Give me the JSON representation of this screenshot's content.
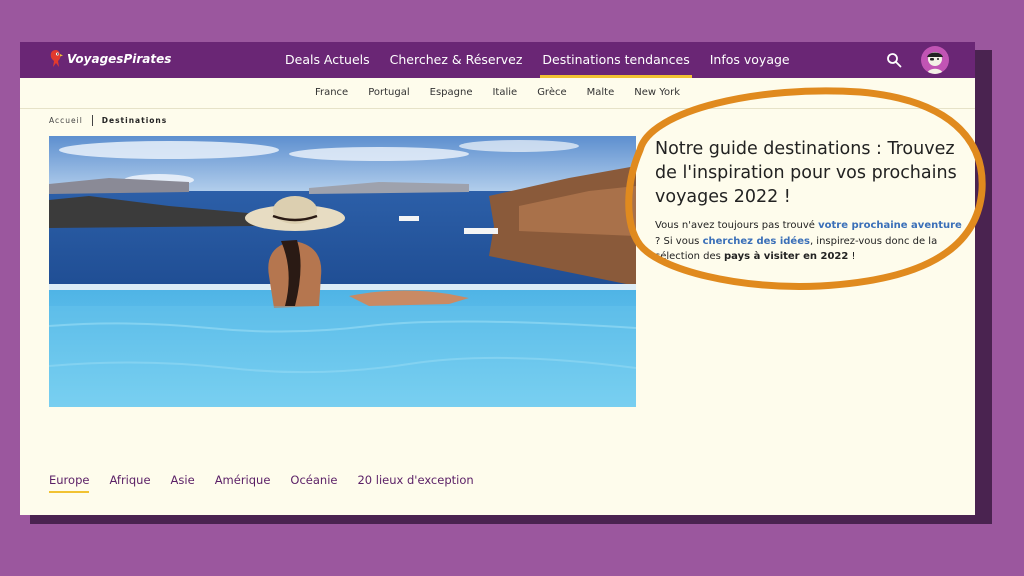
{
  "brand": {
    "name": "VoyagesPirates"
  },
  "nav": {
    "items": [
      {
        "label": "Deals Actuels",
        "active": false
      },
      {
        "label": "Cherchez & Réservez",
        "active": false
      },
      {
        "label": "Destinations tendances",
        "active": true
      },
      {
        "label": "Infos voyage",
        "active": false
      }
    ]
  },
  "subnav": {
    "items": [
      "France",
      "Portugal",
      "Espagne",
      "Italie",
      "Grèce",
      "Malte",
      "New York"
    ]
  },
  "breadcrumb": {
    "home": "Accueil",
    "current": "Destinations"
  },
  "intro": {
    "title": "Notre guide destinations : Trouvez de l'inspiration pour vos prochains voyages 2022 !",
    "t1": "Vous n'avez toujours pas trouvé ",
    "link1": "votre prochaine aventure",
    "t2": " ? Si vous ",
    "link2": "cherchez des idées",
    "t3": ", inspirez-vous donc de la sélection des ",
    "bold": "pays à visiter en 2022",
    "t4": " !"
  },
  "tabs": {
    "items": [
      {
        "label": "Europe",
        "active": true
      },
      {
        "label": "Afrique",
        "active": false
      },
      {
        "label": "Asie",
        "active": false
      },
      {
        "label": "Amérique",
        "active": false
      },
      {
        "label": "Océanie",
        "active": false
      },
      {
        "label": "20 lieux d'exception",
        "active": false
      }
    ]
  },
  "colors": {
    "background": "#9b579e",
    "topbar": "#6a2675",
    "page": "#fefcec",
    "accent": "#f1c232",
    "link": "#3a6fb8",
    "annotation_ring": "#e08a1e"
  },
  "icons": {
    "search": "search-icon",
    "avatar": "pirate-avatar-icon",
    "logo": "parrot-logo-icon"
  }
}
